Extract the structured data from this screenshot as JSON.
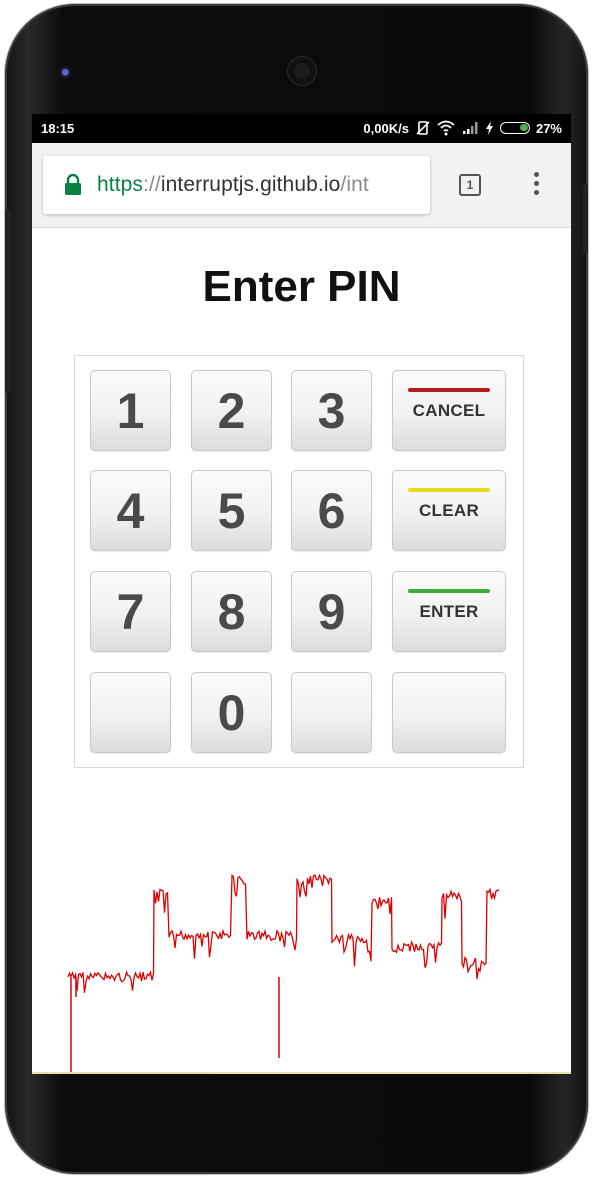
{
  "status_bar": {
    "time": "18:15",
    "net_speed": "0,00K/s",
    "battery_percent": "27%",
    "icons": [
      "vibrate-off-icon",
      "wifi-icon",
      "signal-icon",
      "charging-icon",
      "battery-icon"
    ]
  },
  "browser": {
    "url_scheme": "https",
    "url_sep": "://",
    "url_host": "interruptjs.github.io",
    "url_path": "/int",
    "tab_count": "1",
    "secure_color": "#0b8043"
  },
  "page": {
    "title": "Enter PIN",
    "keys": {
      "k1": "1",
      "k2": "2",
      "k3": "3",
      "k4": "4",
      "k5": "5",
      "k6": "6",
      "k7": "7",
      "k8": "8",
      "k9": "9",
      "k0": "0"
    },
    "functions": {
      "cancel": {
        "label": "CANCEL",
        "color": "#b51d1d"
      },
      "clear": {
        "label": "CLEAR",
        "color": "#e6dc1e"
      },
      "enter": {
        "label": "ENTER",
        "color": "#3fae3f"
      }
    }
  },
  "trace": {
    "color": "#dd0000",
    "levels": [
      0.3,
      0.85,
      0.58,
      0.95,
      0.55,
      0.8,
      0.5,
      0.4
    ]
  }
}
